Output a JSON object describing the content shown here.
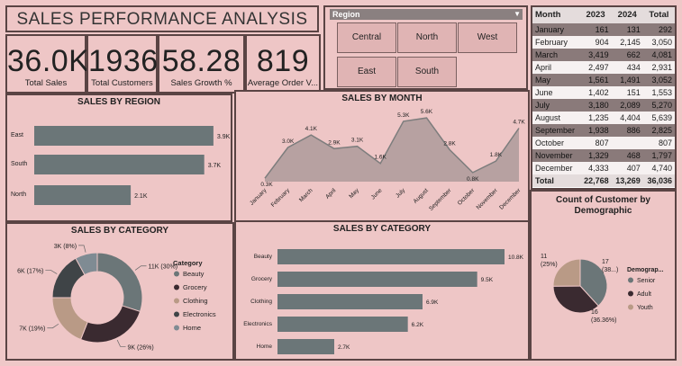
{
  "header": {
    "title": "SALES PERFORMANCE ANALYSIS"
  },
  "kpis": [
    {
      "value": "36.0K",
      "label": "Total Sales"
    },
    {
      "value": "1936",
      "label": "Total Customers"
    },
    {
      "value": "58.28",
      "label": "Sales Growth %"
    },
    {
      "value": "819",
      "label": "Average Order V..."
    }
  ],
  "slicer": {
    "title": "Region",
    "options": [
      "Central",
      "North",
      "West",
      "East",
      "South"
    ]
  },
  "month_table": {
    "headers": [
      "Month",
      "2023",
      "2024",
      "Total"
    ],
    "rows": [
      [
        "January",
        "161",
        "131",
        "292"
      ],
      [
        "February",
        "904",
        "2,145",
        "3,050"
      ],
      [
        "March",
        "3,419",
        "662",
        "4,081"
      ],
      [
        "April",
        "2,497",
        "434",
        "2,931"
      ],
      [
        "May",
        "1,561",
        "1,491",
        "3,052"
      ],
      [
        "June",
        "1,402",
        "151",
        "1,553"
      ],
      [
        "July",
        "3,180",
        "2,089",
        "5,270"
      ],
      [
        "August",
        "1,235",
        "4,404",
        "5,639"
      ],
      [
        "September",
        "1,938",
        "886",
        "2,825"
      ],
      [
        "October",
        "807",
        "",
        "807"
      ],
      [
        "November",
        "1,329",
        "468",
        "1,797"
      ],
      [
        "December",
        "4,333",
        "407",
        "4,740"
      ]
    ],
    "total": [
      "Total",
      "22,768",
      "13,269",
      "36,036"
    ]
  },
  "chart_data": [
    {
      "id": "region",
      "type": "bar",
      "title": "SALES BY REGION",
      "categories": [
        "East",
        "South",
        "North"
      ],
      "values": [
        3.9,
        3.7,
        2.1
      ],
      "labels": [
        "3.9K",
        "3.7K",
        "2.1K"
      ],
      "unit": "K",
      "color": "#6b7678"
    },
    {
      "id": "month",
      "type": "area",
      "title": "SALES BY MONTH",
      "categories": [
        "January",
        "February",
        "March",
        "April",
        "May",
        "June",
        "July",
        "August",
        "September",
        "October",
        "November",
        "December"
      ],
      "values": [
        0.3,
        3.0,
        4.1,
        2.9,
        3.1,
        1.6,
        5.3,
        5.6,
        2.8,
        0.8,
        1.8,
        4.7
      ],
      "labels": [
        "0.3K",
        "3.0K",
        "4.1K",
        "2.9K",
        "3.1K",
        "1.6K",
        "5.3K",
        "5.6K",
        "2.8K",
        "0.8K",
        "1.8K",
        "4.7K"
      ],
      "fill": "#b7a1a1",
      "stroke": "#7d7d7d"
    },
    {
      "id": "category_donut",
      "type": "pie",
      "title": "SALES BY CATEGORY",
      "legend_title": "Category",
      "categories": [
        "Beauty",
        "Grocery",
        "Clothing",
        "Electronics",
        "Home"
      ],
      "values": [
        30,
        26,
        19,
        17,
        8
      ],
      "labels": [
        "11K (30%)",
        "9K (26%)",
        "7K (19%)",
        "6K (17%)",
        "3K (8%)"
      ],
      "colors": [
        "#6b7678",
        "#3a2a30",
        "#b99a86",
        "#3f4447",
        "#7f8b93"
      ]
    },
    {
      "id": "category_bar",
      "type": "bar",
      "title": "SALES BY CATEGORY",
      "categories": [
        "Beauty",
        "Grocery",
        "Clothing",
        "Electronics",
        "Home"
      ],
      "values": [
        10.8,
        9.5,
        6.9,
        6.2,
        2.7
      ],
      "labels": [
        "10.8K",
        "9.5K",
        "6.9K",
        "6.2K",
        "2.7K"
      ],
      "color": "#6b7678"
    },
    {
      "id": "demographic",
      "type": "pie",
      "title": "Count of Customer by Demographic",
      "legend_title": "Demograp...",
      "categories": [
        "Senior",
        "Adult",
        "Youth"
      ],
      "values": [
        38,
        36.36,
        25
      ],
      "labels": [
        "17\n(38...)",
        "16\n(36.36%)",
        "11\n(25%)"
      ],
      "colors": [
        "#6b7678",
        "#3a2a30",
        "#b99a86"
      ]
    }
  ]
}
